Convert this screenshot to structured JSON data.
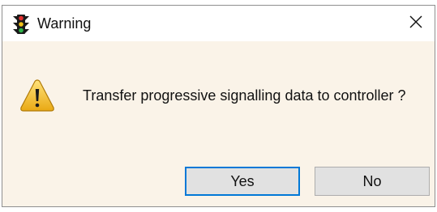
{
  "window": {
    "title": "Warning",
    "app_icon": "traffic-light-icon",
    "close_icon": "close-icon"
  },
  "message": {
    "icon": "warning-triangle-icon",
    "text": "Transfer progressive signalling data to controller ?"
  },
  "buttons": {
    "yes_label": "Yes",
    "no_label": "No"
  },
  "colors": {
    "dialog_background": "#faf3e8",
    "titlebar_background": "#ffffff",
    "button_face": "#e1e1e1",
    "default_button_border": "#0078d7",
    "warning_yellow": "#f4c020"
  }
}
